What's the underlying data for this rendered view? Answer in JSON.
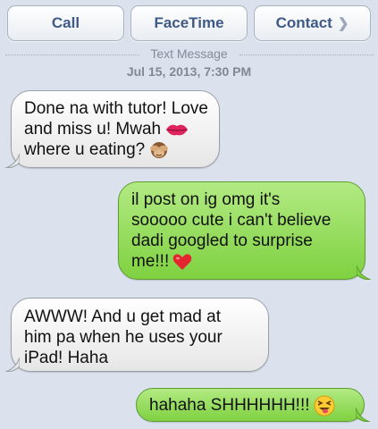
{
  "toolbar": {
    "call_label": "Call",
    "facetime_label": "FaceTime",
    "contact_label": "Contact"
  },
  "thread": {
    "label": "Text Message",
    "timestamp": "Jul 15, 2013, 7:30 PM"
  },
  "messages": [
    {
      "direction": "incoming",
      "lines": [
        "Done na with tutor! Love",
        "and miss u! Mwah",
        "where u eating?"
      ]
    },
    {
      "direction": "outgoing",
      "lines": [
        "il post on ig omg it's",
        "sooooo cute i can't believe",
        "dadi googled to surprise",
        "me!!!"
      ]
    },
    {
      "direction": "incoming",
      "lines": [
        "AWWW! And u get mad at",
        "him pa when he uses your",
        "iPad! Haha"
      ]
    },
    {
      "direction": "outgoing",
      "lines": [
        "hahaha SHHHHHH!!!"
      ]
    }
  ],
  "icons": {
    "contact_chevron": "chevron-right-icon",
    "kiss": "kiss-lips-emoji",
    "see_no_evil": "see-no-evil-monkey-emoji",
    "heart": "red-heart-emoji",
    "tongue": "squinting-tongue-emoji"
  },
  "colors": {
    "background": "#dbe2ed",
    "incoming_bubble": "#ffffff",
    "outgoing_bubble": "#8ed851",
    "toolbar_text": "#3f5a86"
  }
}
